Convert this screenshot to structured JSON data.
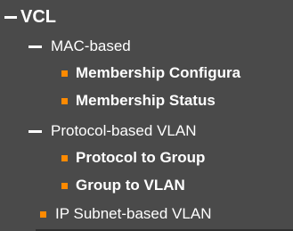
{
  "nav": {
    "vcl": {
      "label": "VCL",
      "state": "expanded"
    },
    "mac_based": {
      "label": "MAC-based",
      "state": "expanded",
      "items": [
        {
          "label": "Membership Configura"
        },
        {
          "label": "Membership Status"
        }
      ]
    },
    "protocol_based": {
      "label": "Protocol-based VLAN",
      "state": "expanded",
      "items": [
        {
          "label": "Protocol to Group"
        },
        {
          "label": "Group to VLAN"
        }
      ]
    },
    "ip_subnet": {
      "label": "IP Subnet-based VLAN"
    }
  },
  "colors": {
    "background": "#4a4a4a",
    "text": "#ffffff",
    "bullet": "#ff8a00"
  },
  "icons": {
    "expanded": "dash-collapse-icon",
    "leaf": "orange-square-bullet-icon"
  }
}
